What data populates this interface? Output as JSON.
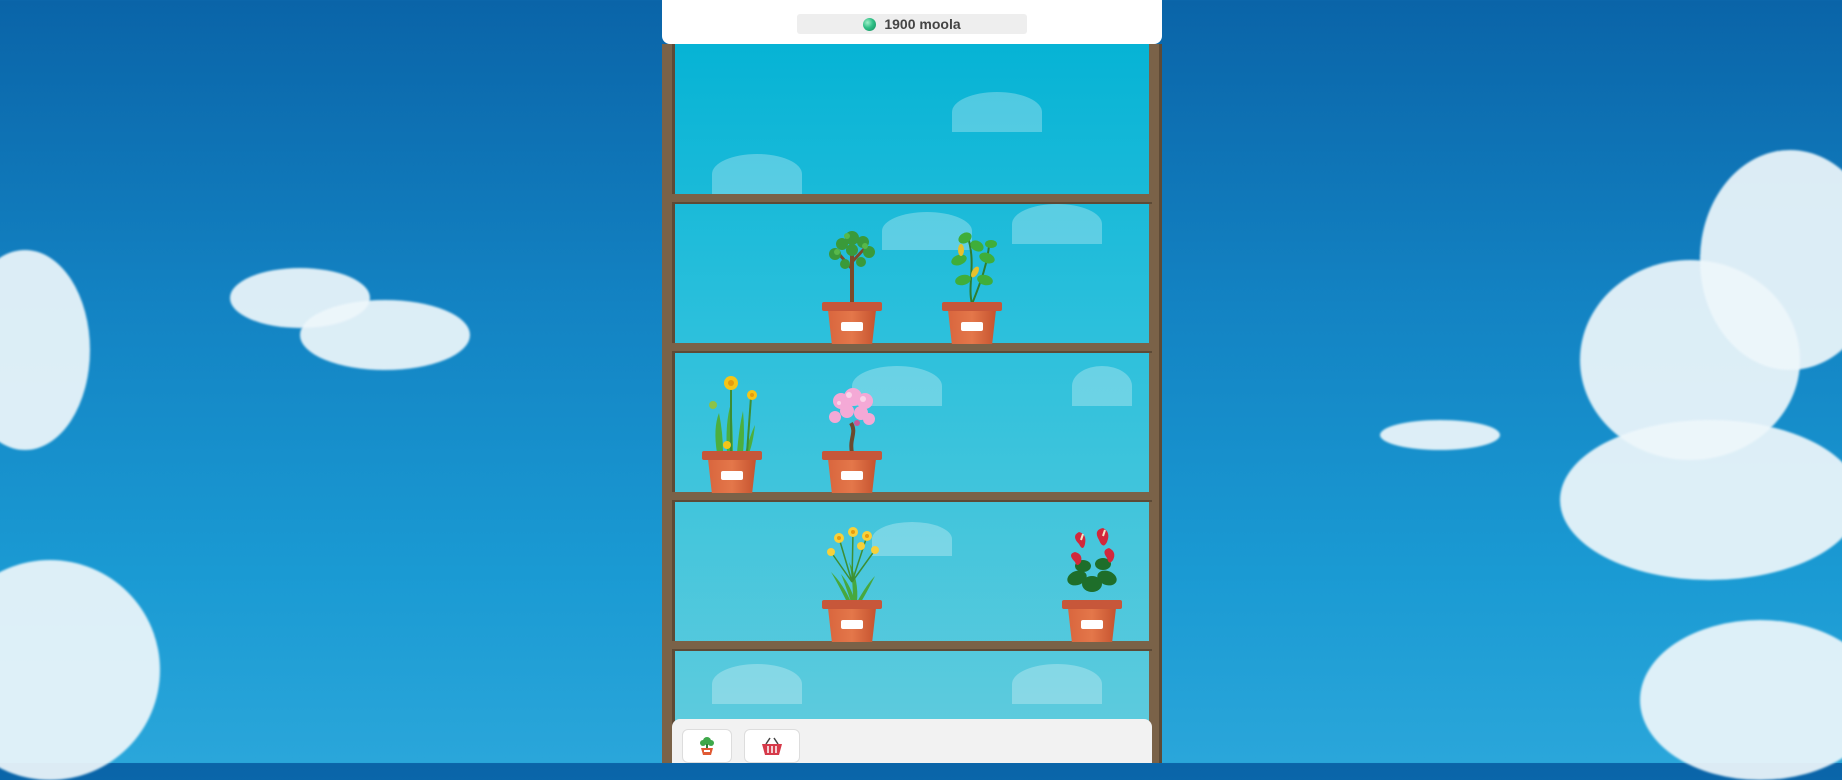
{
  "currency": {
    "amount_label": "1900 moola",
    "icon": "coin-icon"
  },
  "shelves": [
    {
      "slots": []
    },
    {
      "slots": [
        {
          "plant": "jade-tree-icon"
        },
        {
          "plant": "pothos-vine-icon"
        }
      ]
    },
    {
      "slots": [
        {
          "plant": "yellow-daffodil-icon"
        },
        {
          "plant": "pink-blossom-bonsai-icon"
        }
      ]
    },
    {
      "slots": [
        {
          "plant": "yellow-flower-bunch-icon"
        },
        {
          "plant": "red-anthurium-icon"
        }
      ]
    },
    {
      "slots": []
    }
  ],
  "toolbar": {
    "buttons": [
      {
        "icon": "potted-plant-icon"
      },
      {
        "icon": "shopping-basket-icon"
      }
    ]
  },
  "colors": {
    "wood": "#7a6248",
    "pot": "#d9663e",
    "shelf_bg_top": "#06b3d5",
    "shelf_bg_bottom": "#62ccdd",
    "coin": "#2fbf86"
  }
}
